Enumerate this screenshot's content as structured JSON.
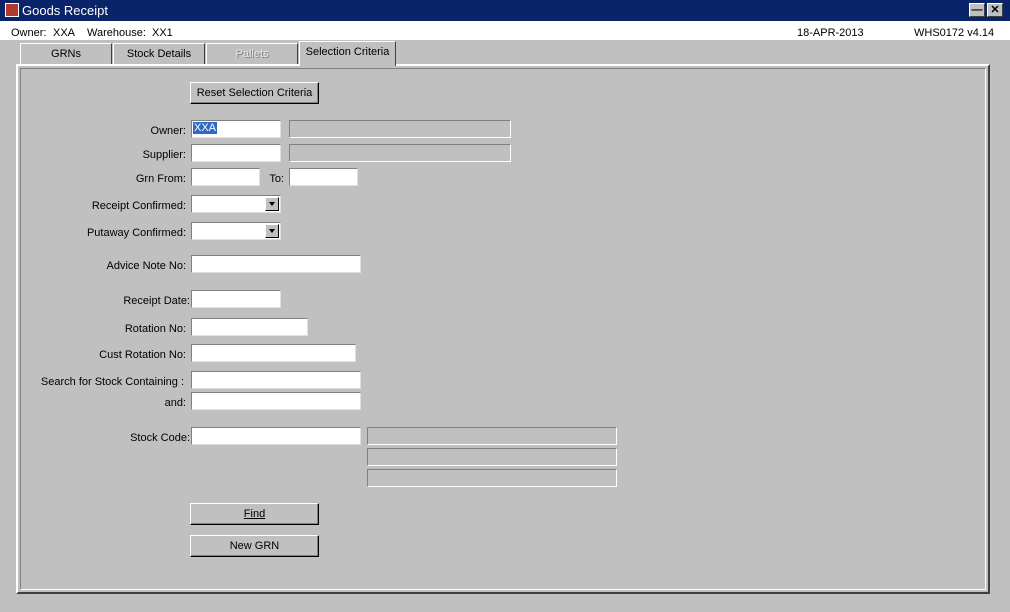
{
  "window": {
    "title": "Goods Receipt"
  },
  "info": {
    "owner_label": "Owner:",
    "owner_value": "XXA",
    "warehouse_label": "Warehouse:",
    "warehouse_value": "XX1",
    "date": "18-APR-2013",
    "program": "WHS0172  v4.14"
  },
  "tabs": [
    {
      "label": "GRNs"
    },
    {
      "label": "Stock Details"
    },
    {
      "label": "Pallets"
    },
    {
      "label": "Selection Criteria"
    }
  ],
  "form": {
    "reset_label": "Reset Selection Criteria",
    "owner_label": "Owner:",
    "owner_value": "XXA",
    "supplier_label": "Supplier:",
    "grn_from_label": "Grn From:",
    "grn_to_label": "To:",
    "receipt_confirmed_label": "Receipt Confirmed:",
    "putaway_confirmed_label": "Putaway Confirmed:",
    "advice_note_label": "Advice Note No:",
    "receipt_date_label": "Receipt Date:",
    "rotation_label": "Rotation No:",
    "cust_rotation_label": "Cust Rotation No:",
    "search_label": "Search for Stock Containing :",
    "and_label": "and:",
    "stock_code_label": "Stock Code:",
    "find_label": "Find",
    "new_grn_label": "New GRN"
  }
}
